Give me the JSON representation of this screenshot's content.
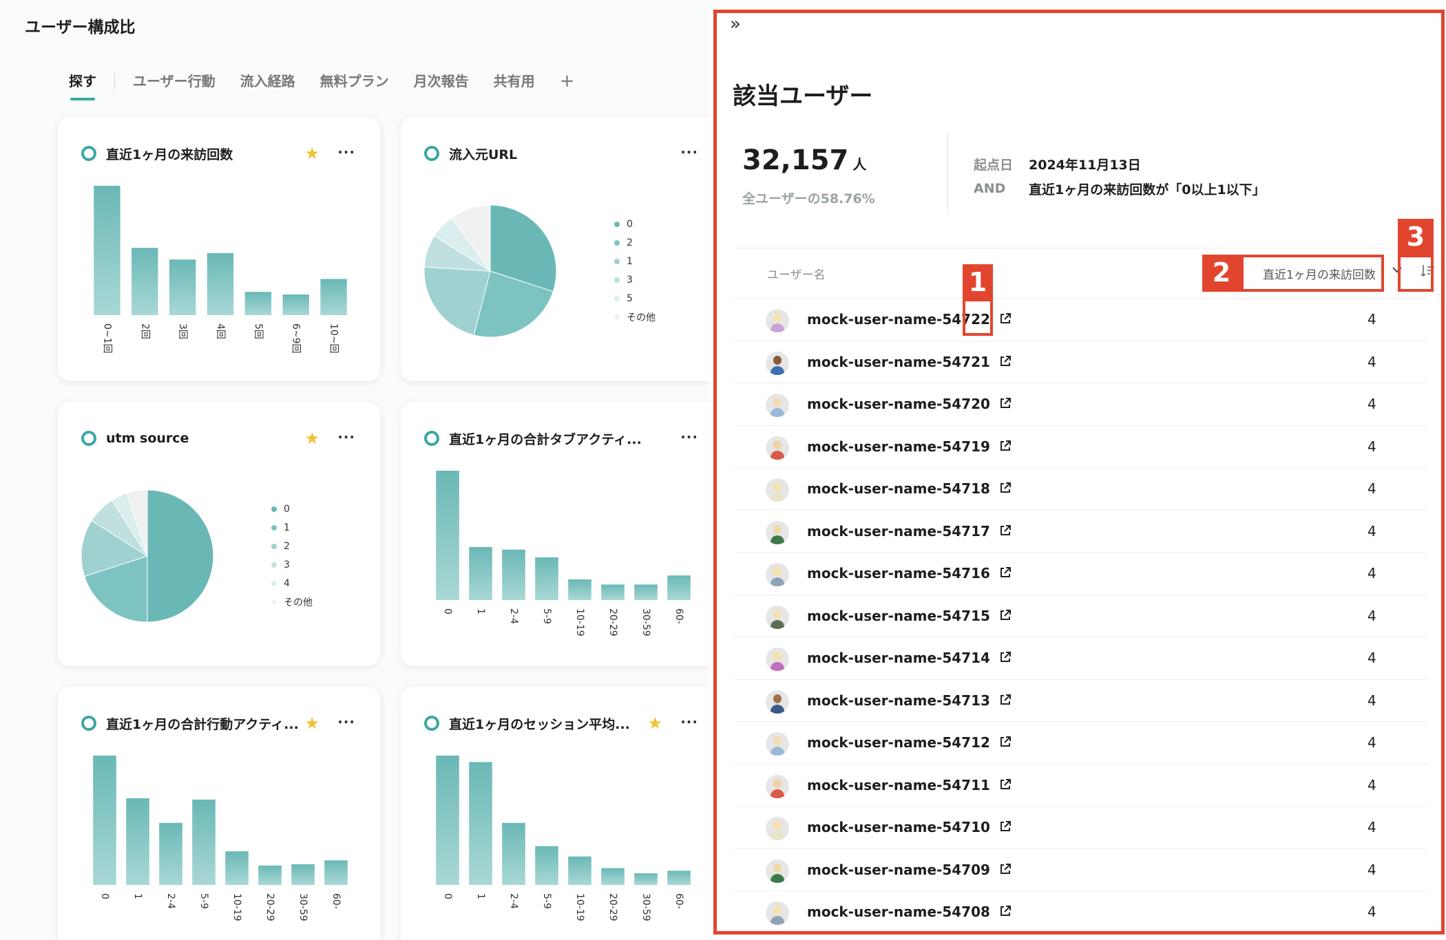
{
  "page": {
    "title": "ユーザー構成比"
  },
  "tabs": [
    "探す",
    "ユーザー行動",
    "流入経路",
    "無料プラン",
    "月次報告",
    "共有用"
  ],
  "tab_add": "+",
  "cards": [
    {
      "title": "直近1ヶ月の来訪回数",
      "starred": true,
      "more": "···"
    },
    {
      "title": "流入元URL",
      "starred": false,
      "more": "···"
    },
    {
      "title": "utm source",
      "starred": true,
      "more": "···"
    },
    {
      "title": "直近1ヶ月の合計タブアクティ...",
      "starred": false,
      "more": "···"
    },
    {
      "title": "直近1ヶ月の合計行動アクティ...",
      "starred": true,
      "more": "···"
    },
    {
      "title": "直近1ヶ月のセッション平均...",
      "starred": true,
      "more": "···"
    }
  ],
  "chart_data": [
    {
      "type": "bar",
      "categories": [
        "0~1回",
        "2回",
        "3回",
        "4回",
        "5回",
        "6~9回",
        "10~回"
      ],
      "values": [
        100,
        52,
        43,
        48,
        18,
        16,
        28
      ]
    },
    {
      "type": "pie",
      "categories": [
        "0",
        "2",
        "1",
        "3",
        "5",
        "その他"
      ],
      "values": [
        30,
        24,
        22,
        8,
        6,
        10
      ]
    },
    {
      "type": "pie",
      "categories": [
        "0",
        "1",
        "2",
        "3",
        "4",
        "その他"
      ],
      "values": [
        50,
        20,
        14,
        7,
        4,
        5
      ]
    },
    {
      "type": "bar",
      "categories": [
        "0",
        "1",
        "2-4",
        "5-9",
        "10-19",
        "20-29",
        "30-59",
        "60-"
      ],
      "values": [
        100,
        41,
        39,
        33,
        16,
        12,
        12,
        19
      ]
    },
    {
      "type": "bar",
      "categories": [
        "0",
        "1",
        "2-4",
        "5-9",
        "10-19",
        "20-29",
        "30-59",
        "60-"
      ],
      "values": [
        100,
        67,
        48,
        66,
        26,
        15,
        16,
        19
      ]
    },
    {
      "type": "bar",
      "categories": [
        "0",
        "1",
        "2-4",
        "5-9",
        "10-19",
        "20-29",
        "30-59",
        "60-"
      ],
      "values": [
        100,
        95,
        48,
        30,
        22,
        13,
        9,
        11
      ]
    }
  ],
  "panel": {
    "collapse": "»",
    "title": "該当ユーザー",
    "count": "32,157",
    "unit": "人",
    "ratio": "全ユーザーの58.76%",
    "conditions": [
      {
        "key": "起点日",
        "value": "2024年11月13日"
      },
      {
        "key": "AND",
        "value": "直近1ヶ月の来訪回数が「0以上1以下」"
      }
    ],
    "col_name": "ユーザー名",
    "col_sort": "直近1ヶ月の来訪回数",
    "annotations": [
      "1",
      "2",
      "3"
    ],
    "rows": [
      {
        "name": "mock-user-name-54722",
        "value": "4",
        "face": "#f6e2b0",
        "shirt": "#c8a3d8"
      },
      {
        "name": "mock-user-name-54721",
        "value": "4",
        "face": "#8a5a3c",
        "shirt": "#3d6fb0"
      },
      {
        "name": "mock-user-name-54720",
        "value": "4",
        "face": "#f3dcb5",
        "shirt": "#9ab9d6"
      },
      {
        "name": "mock-user-name-54719",
        "value": "4",
        "face": "#f0d2a8",
        "shirt": "#d9594a"
      },
      {
        "name": "mock-user-name-54718",
        "value": "4",
        "face": "#f6e2b0",
        "shirt": "#e9e3c8"
      },
      {
        "name": "mock-user-name-54717",
        "value": "4",
        "face": "#f0d8a8",
        "shirt": "#3d7a4a"
      },
      {
        "name": "mock-user-name-54716",
        "value": "4",
        "face": "#f6e2b0",
        "shirt": "#8ea3b8"
      },
      {
        "name": "mock-user-name-54715",
        "value": "4",
        "face": "#f6e2b0",
        "shirt": "#5d6f52"
      },
      {
        "name": "mock-user-name-54714",
        "value": "4",
        "face": "#f6e2b0",
        "shirt": "#c36fc0"
      },
      {
        "name": "mock-user-name-54713",
        "value": "4",
        "face": "#a0704c",
        "shirt": "#3a5a8a"
      },
      {
        "name": "mock-user-name-54712",
        "value": "4",
        "face": "#f3dcb5",
        "shirt": "#9ab9d6"
      },
      {
        "name": "mock-user-name-54711",
        "value": "4",
        "face": "#f0d2a8",
        "shirt": "#d9594a"
      },
      {
        "name": "mock-user-name-54710",
        "value": "4",
        "face": "#f6e2b0",
        "shirt": "#e9e3c8"
      },
      {
        "name": "mock-user-name-54709",
        "value": "4",
        "face": "#f0d8a8",
        "shirt": "#3d7a4a"
      },
      {
        "name": "mock-user-name-54708",
        "value": "4",
        "face": "#f6e2b0",
        "shirt": "#8ea3b8"
      }
    ]
  },
  "colors": {
    "accent": "#3aa7a2",
    "annotation": "#e2452e",
    "bar_top": "#6ab8b6",
    "bar_bottom": "#a9d8d6",
    "pie": [
      "#6ab8b6",
      "#7cc3c2",
      "#9fd1d0",
      "#bfe0df",
      "#d9eeed",
      "#f0f2f2"
    ]
  }
}
